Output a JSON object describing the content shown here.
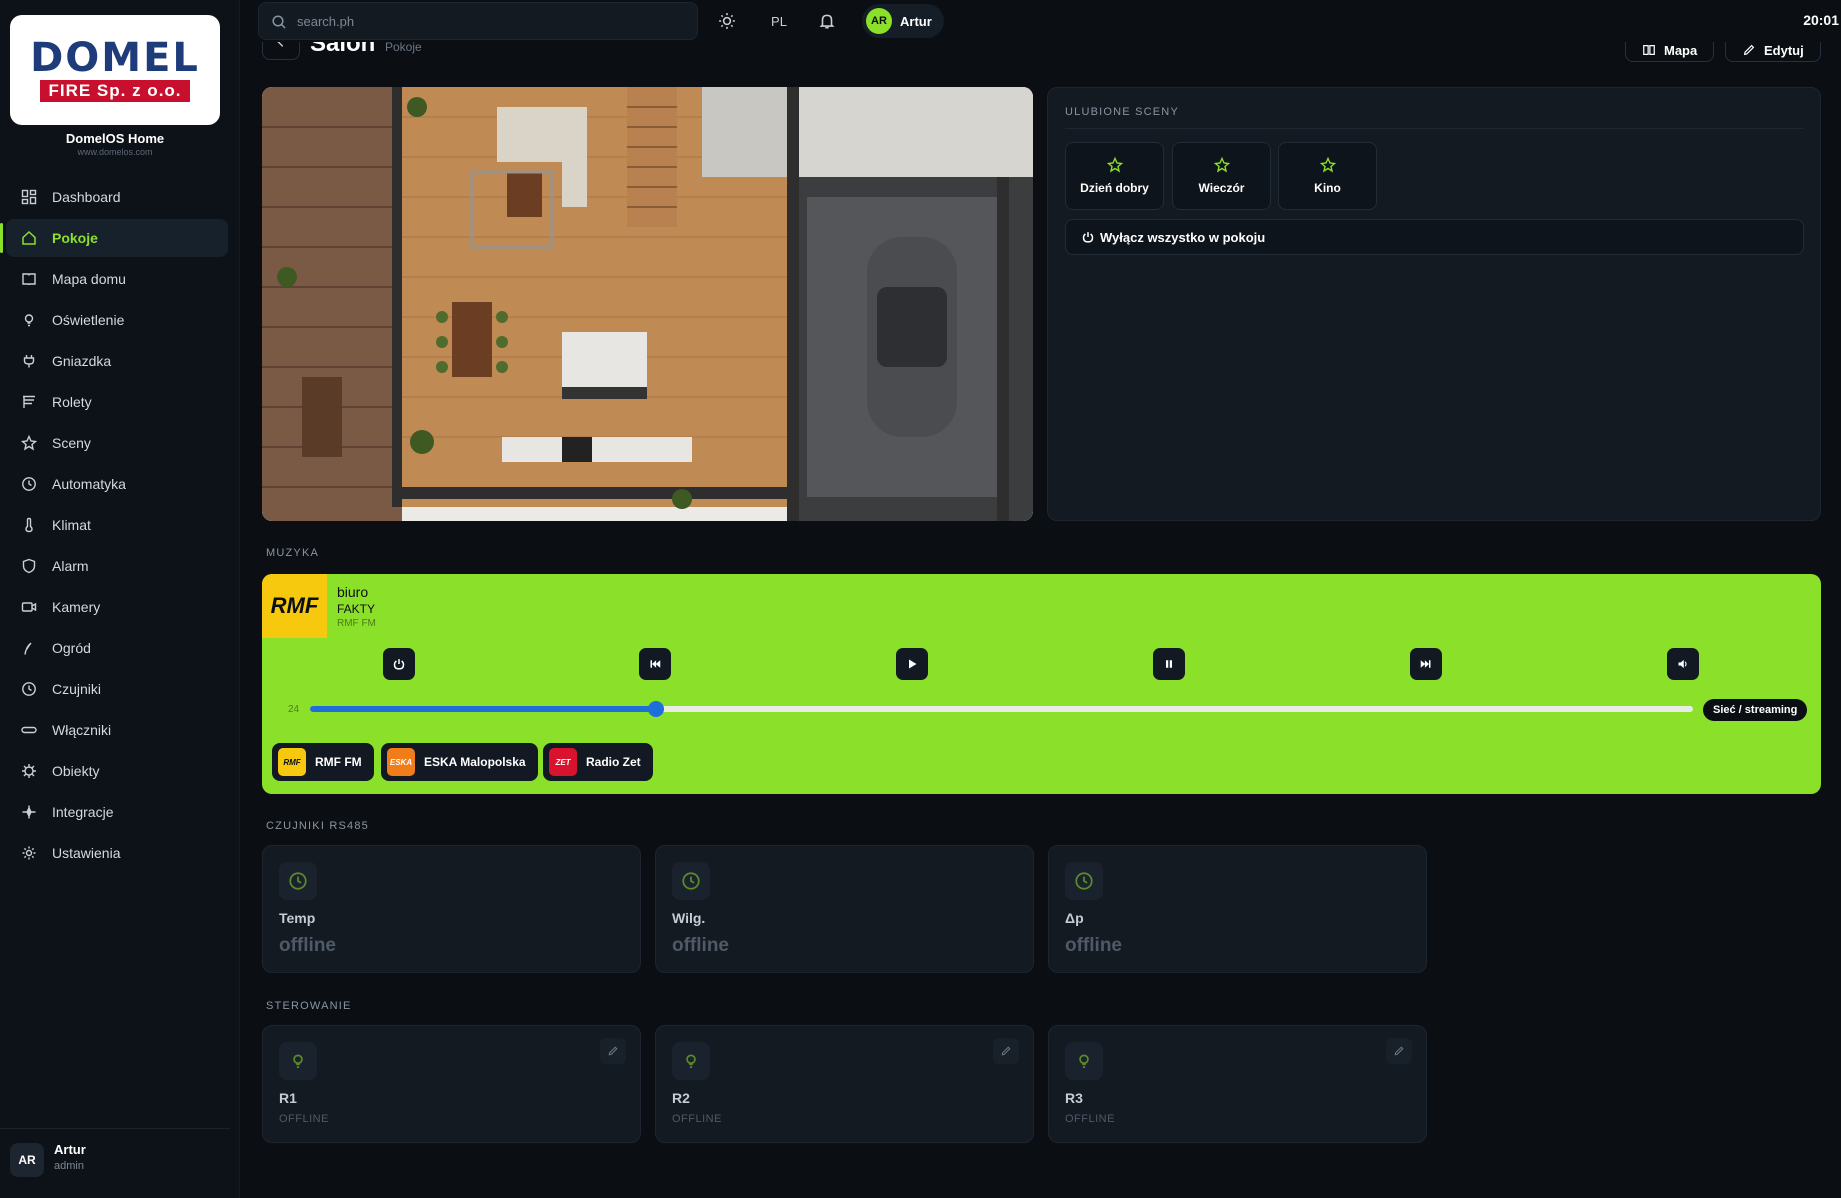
{
  "brand": {
    "logo_main": "DOMEL",
    "logo_sub": "FIRE Sp. z o.o.",
    "name": "DomelOS Home",
    "url": "www.domelos.com"
  },
  "sidebar": {
    "items": [
      {
        "label": "Dashboard",
        "icon": "dashboard-icon"
      },
      {
        "label": "Pokoje",
        "icon": "home-icon",
        "active": true
      },
      {
        "label": "Mapa domu",
        "icon": "map-icon"
      },
      {
        "label": "Oświetlenie",
        "icon": "bulb-icon"
      },
      {
        "label": "Gniazdka",
        "icon": "plug-icon"
      },
      {
        "label": "Rolety",
        "icon": "blinds-icon"
      },
      {
        "label": "Sceny",
        "icon": "star-icon"
      },
      {
        "label": "Automatyka",
        "icon": "clock-icon"
      },
      {
        "label": "Klimat",
        "icon": "thermometer-icon"
      },
      {
        "label": "Alarm",
        "icon": "shield-icon"
      },
      {
        "label": "Kamery",
        "icon": "camera-icon"
      },
      {
        "label": "Ogród",
        "icon": "leaf-icon"
      },
      {
        "label": "Czujniki",
        "icon": "sensor-icon"
      },
      {
        "label": "Włączniki",
        "icon": "switch-icon"
      },
      {
        "label": "Obiekty",
        "icon": "chip-icon"
      },
      {
        "label": "Integracje",
        "icon": "sparkle-icon"
      },
      {
        "label": "Ustawienia",
        "icon": "gear-icon"
      }
    ],
    "user": {
      "initials": "AR",
      "name": "Artur",
      "role": "admin"
    }
  },
  "topbar": {
    "search_placeholder": "search.ph",
    "language": "PL",
    "user_initials": "AR",
    "user_name": "Artur",
    "clock": "20:01"
  },
  "page": {
    "title": "Salon",
    "breadcrumb": "Pokoje",
    "map_button": "Mapa",
    "edit_button": "Edytuj"
  },
  "scenes": {
    "label": "ULUBIONE SCENY",
    "items": [
      "Dzień dobry",
      "Wieczór",
      "Kino"
    ],
    "all_off": "Wyłącz wszystko w pokoju"
  },
  "music": {
    "label": "MUZYKA",
    "logo_text": "RMF",
    "room": "biuro",
    "title": "FAKTY",
    "station": "RMF FM",
    "volume": 24,
    "volume_fraction": 0.25,
    "mode": "Sieć / streaming",
    "stations": [
      {
        "name": "RMF FM",
        "logo": "RMF",
        "color": "#f6c90e",
        "text": "#0b0f14"
      },
      {
        "name": "ESKA Malopolska",
        "logo": "ESKA",
        "color": "#f07d1a",
        "text": "#ffffff"
      },
      {
        "name": "Radio Zet",
        "logo": "ZET",
        "color": "#d9132d",
        "text": "#ffffff"
      }
    ]
  },
  "sensors": {
    "label": "CZUJNIKI RS485",
    "items": [
      {
        "name": "Temp",
        "value": "offline"
      },
      {
        "name": "Wilg.",
        "value": "offline"
      },
      {
        "name": "Δp",
        "value": "offline"
      }
    ]
  },
  "control": {
    "label": "STEROWANIE",
    "items": [
      {
        "name": "R1",
        "state": "OFFLINE"
      },
      {
        "name": "R2",
        "state": "OFFLINE"
      },
      {
        "name": "R3",
        "state": "OFFLINE"
      }
    ]
  },
  "colors": {
    "accent": "#8be02a",
    "background": "#0b0f14",
    "card": "#131a22",
    "volume": "#1d6fd9"
  }
}
